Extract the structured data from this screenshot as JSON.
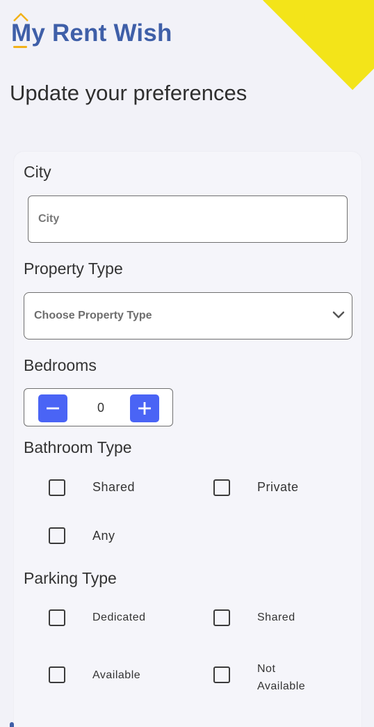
{
  "brand": {
    "logo_text": "My Rent Wish",
    "colors": {
      "brand_blue": "#3f5fa8",
      "accent_yellow": "#f3e419",
      "button_blue": "#4a64f5",
      "roof_orange": "#f2b21a"
    }
  },
  "header": {
    "title": "Update your preferences"
  },
  "city": {
    "label": "City",
    "placeholder": "City",
    "value": ""
  },
  "property_type": {
    "label": "Property Type",
    "placeholder": "Choose Property Type",
    "icon": "chevron-down-icon"
  },
  "bedrooms": {
    "label": "Bedrooms",
    "value": "0",
    "minus_icon": "minus-icon",
    "plus_icon": "plus-icon"
  },
  "bathroom": {
    "label": "Bathroom Type",
    "options": [
      {
        "label": "Shared",
        "checked": false
      },
      {
        "label": "Private",
        "checked": false
      },
      {
        "label": "Any",
        "checked": false
      }
    ]
  },
  "parking": {
    "label": "Parking Type",
    "options": [
      {
        "label": "Dedicated",
        "checked": false
      },
      {
        "label": "Shared",
        "checked": false
      },
      {
        "label": "Available",
        "checked": false
      },
      {
        "label": "Not Available",
        "checked": false
      }
    ]
  }
}
